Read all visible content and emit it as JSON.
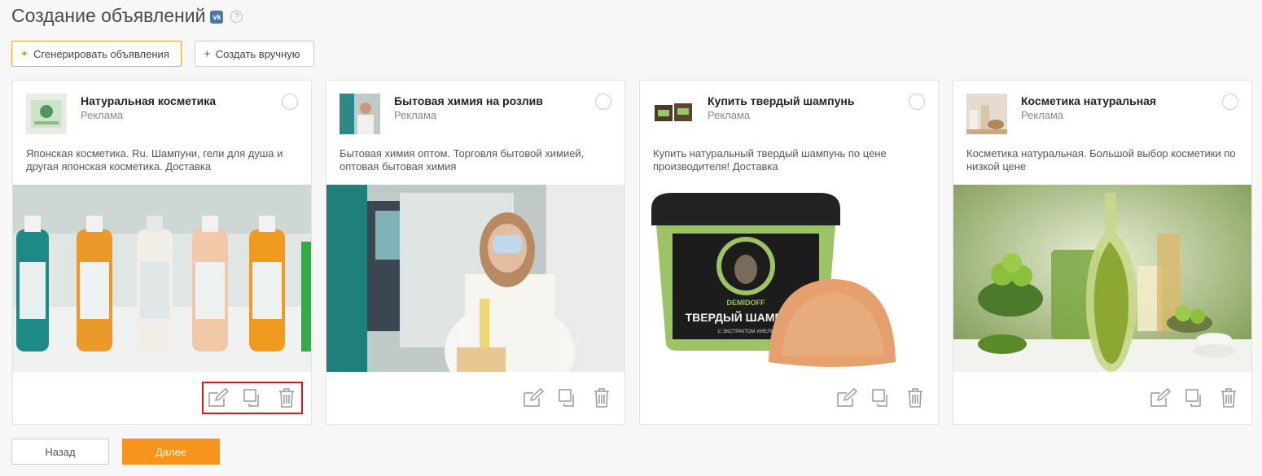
{
  "page": {
    "title": "Создание объявлений",
    "vk_badge": "vk",
    "help": "?"
  },
  "toolbar": {
    "generate_label": "Сгенерировать объявления",
    "manual_label": "Создать вручную"
  },
  "cards": [
    {
      "title": "Натуральная косметика",
      "subtitle": "Реклама",
      "text": "Японская косметика. Ru. Шампуни, гели для душа и другая японская косметика. Доставка"
    },
    {
      "title": "Бытовая химия на розлив",
      "subtitle": "Реклама",
      "text": "Бытовая химия оптом. Торговля бытовой химией, оптовая бытовая химия"
    },
    {
      "title": "Купить твердый шампунь",
      "subtitle": "Реклама",
      "text": "Купить натуральный твердый шампунь по цене производителя! Доставка"
    },
    {
      "title": "Косметика натуральная",
      "subtitle": "Реклама",
      "text": "Косметика натуральная. Большой выбор косметики по низкой цене"
    }
  ],
  "image_text": {
    "shampoo_label": "ТВЕРДЫЙ ШАМПУНЬ",
    "shampoo_sub": "С ЭКСТРАКТОМ ХМЕЛЯ",
    "shampoo_brand": "DEMIDOFF"
  },
  "footer": {
    "back_label": "Назад",
    "next_label": "Далее"
  },
  "colors": {
    "accent": "#f7941d",
    "highlight": "#e8121c",
    "vk": "#4a76a8"
  }
}
